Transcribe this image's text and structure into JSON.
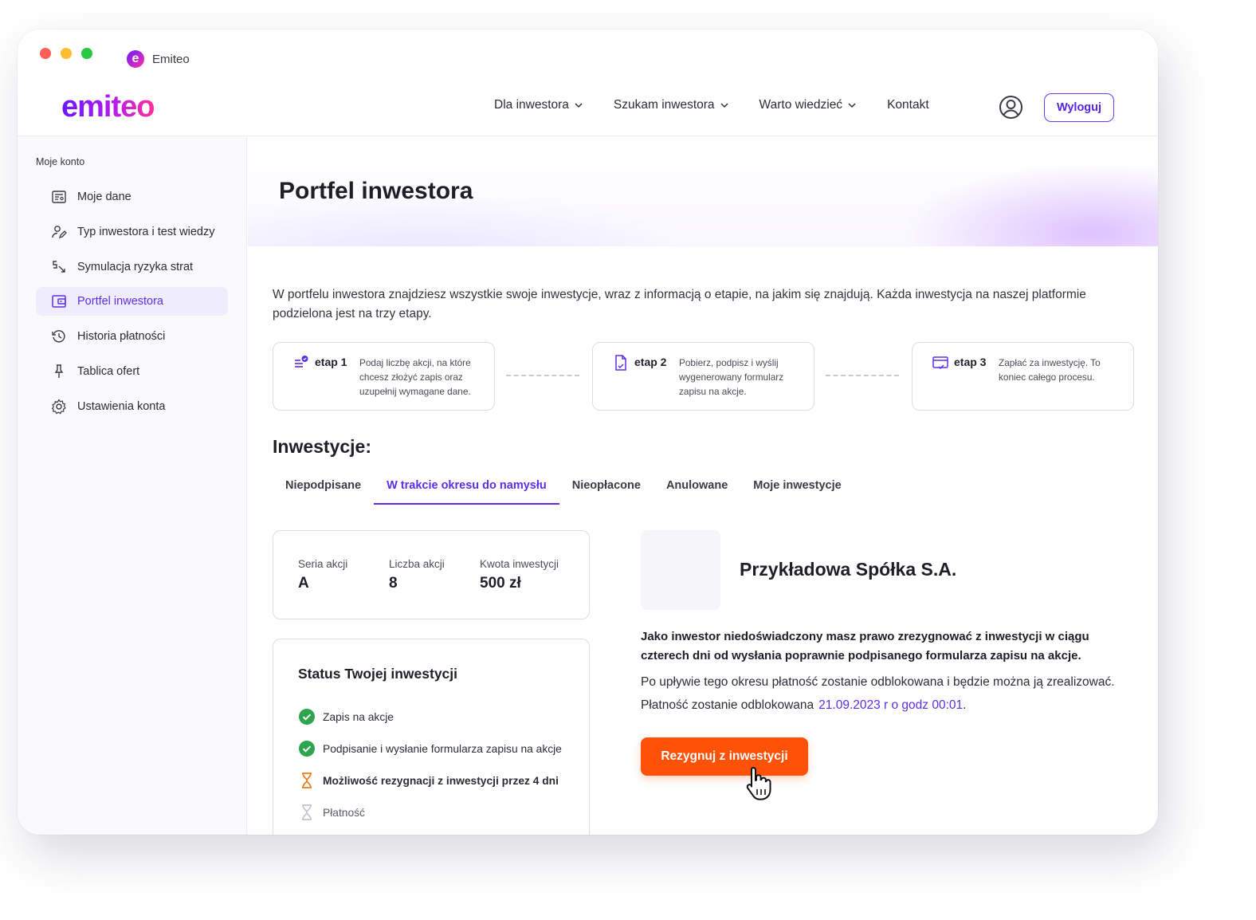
{
  "browser": {
    "tab_title": "Emiteo",
    "favicon_letter": "e"
  },
  "header": {
    "logo_text": "emiteo",
    "nav": [
      {
        "label": "Dla inwestora",
        "has_dropdown": true
      },
      {
        "label": "Szukam inwestora",
        "has_dropdown": true
      },
      {
        "label": "Warto wiedzieć",
        "has_dropdown": true
      },
      {
        "label": "Kontakt",
        "has_dropdown": false
      }
    ],
    "user_icon": "user-circle-icon",
    "logout_label": "Wyloguj"
  },
  "sidebar": {
    "heading": "Moje konto",
    "items": [
      {
        "label": "Moje dane",
        "icon": "profile-card-icon",
        "active": false
      },
      {
        "label": "Typ inwestora i test wiedzy",
        "icon": "user-edit-icon",
        "active": false
      },
      {
        "label": "Symulacja ryzyka strat",
        "icon": "sort-down-icon",
        "active": false
      },
      {
        "label": "Portfel inwestora",
        "icon": "wallet-icon",
        "active": true
      },
      {
        "label": "Historia płatności",
        "icon": "history-icon",
        "active": false
      },
      {
        "label": "Tablica ofert",
        "icon": "pin-icon",
        "active": false
      },
      {
        "label": "Ustawienia konta",
        "icon": "gear-icon",
        "active": false
      }
    ]
  },
  "main": {
    "title": "Portfel inwestora",
    "intro": "W portfelu inwestora znajdziesz wszystkie swoje inwestycje, wraz z informacją o etapie, na jakim się znajdują. Każda inwestycja na naszej platformie podzielona jest na trzy etapy.",
    "steps": [
      {
        "title": "etap 1",
        "description": "Podaj liczbę akcji, na które chcesz złożyć zapis oraz uzupełnij wymagane dane.",
        "icon": "list-check-icon"
      },
      {
        "title": "etap 2",
        "description": "Pobierz, podpisz i wyślij wygenerowany formularz zapisu na akcje.",
        "icon": "document-icon"
      },
      {
        "title": "etap 3",
        "description": "Zapłać za inwestycję. To koniec całego procesu.",
        "icon": "card-payment-icon"
      }
    ],
    "investments_heading": "Inwestycje:",
    "tabs": [
      {
        "label": "Niepodpisane",
        "active": false
      },
      {
        "label": "W trakcie okresu do namysłu",
        "active": true
      },
      {
        "label": "Nieopłacone",
        "active": false
      },
      {
        "label": "Anulowane",
        "active": false
      },
      {
        "label": "Moje inwestycje",
        "active": false
      }
    ],
    "details": {
      "series_label": "Seria akcji",
      "series_value": "A",
      "count_label": "Liczba akcji",
      "count_value": "8",
      "amount_label": "Kwota inwestycji",
      "amount_value": "500 zł"
    },
    "status": {
      "title": "Status Twojej inwestycji",
      "items": [
        {
          "label": "Zapis na akcje",
          "state": "done",
          "icon": "check-circle-icon"
        },
        {
          "label": "Podpisanie i wysłanie formularza zapisu na akcje",
          "state": "done",
          "icon": "check-circle-icon"
        },
        {
          "label": "Możliwość rezygnacji z inwestycji przez 4 dni",
          "state": "in-progress",
          "icon": "hourglass-icon"
        },
        {
          "label": "Płatność",
          "state": "pending",
          "icon": "hourglass-icon"
        }
      ]
    },
    "company": {
      "name": "Przykładowa Spółka S.A.",
      "notice_bold": "Jako inwestor niedoświadczony masz prawo zrezygnować z inwestycji w ciągu czterech dni od wysłania poprawnie podpisanego formularza zapisu na akcje.",
      "notice": "Po upływie tego okresu płatność zostanie odblokowana i będzie można ją zrealizować.",
      "unlock_label": "Płatność zostanie odblokowana",
      "unlock_date": "21.09.2023 r o godz 00:01",
      "unlock_suffix": ".",
      "resign_label": "Rezygnuj z inwestycji"
    }
  },
  "colors": {
    "accent": "#5a2ee6",
    "cta": "#ff5208",
    "success": "#2ea44f",
    "warning": "#f07a1a"
  }
}
